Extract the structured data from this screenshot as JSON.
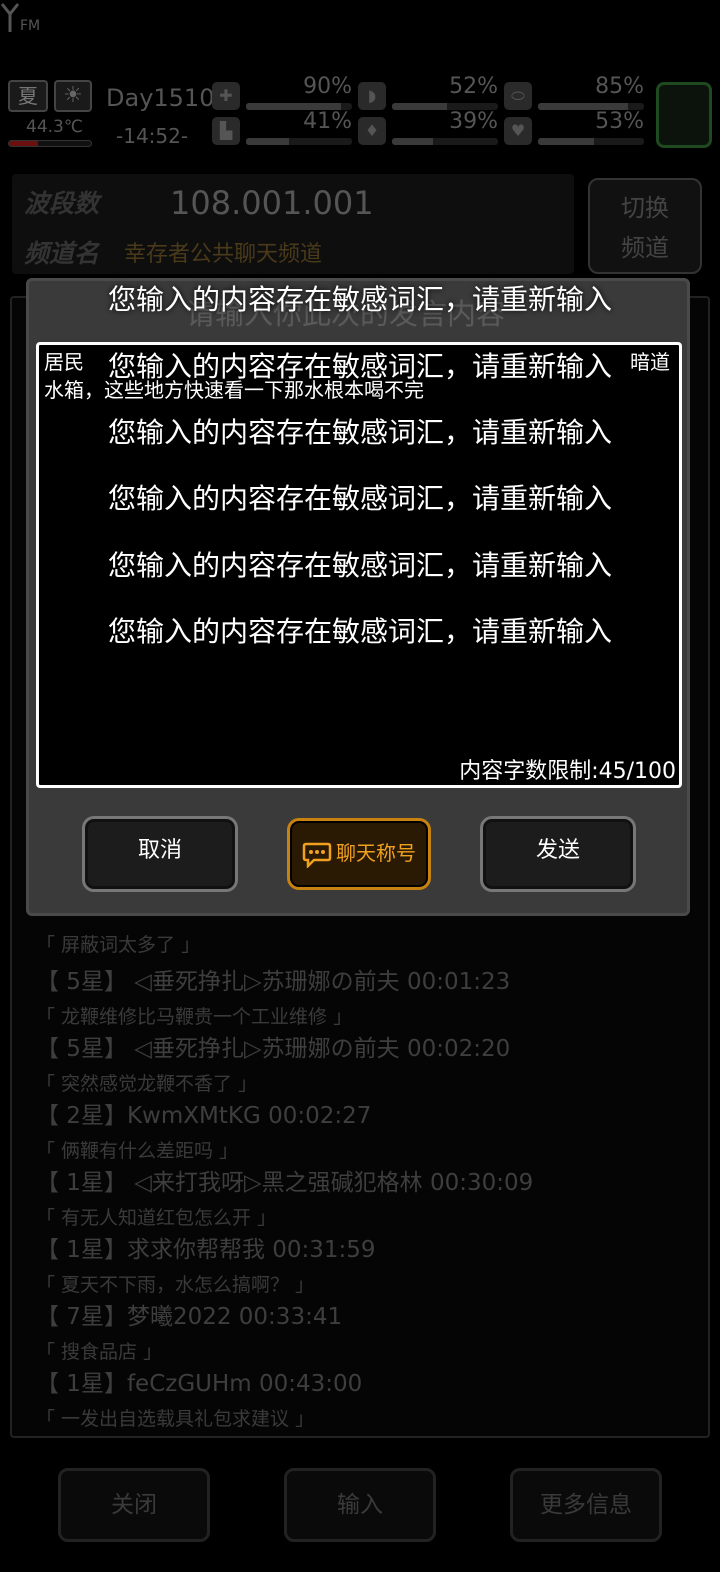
{
  "status": {
    "season": "夏",
    "temperature": "44.3℃",
    "temperature_level": 0.35,
    "day": "Day1510",
    "time": "-14:52-",
    "stats": [
      {
        "icon": "medkit-icon",
        "glyph": "✚",
        "value": "90%",
        "level": 0.9
      },
      {
        "icon": "boot-icon",
        "glyph": "▙",
        "value": "41%",
        "level": 0.41
      },
      {
        "icon": "stomach-icon",
        "glyph": "◗",
        "value": "52%",
        "level": 0.52
      },
      {
        "icon": "water-drop-icon",
        "glyph": "♦",
        "value": "39%",
        "level": 0.39
      },
      {
        "icon": "capsule-icon",
        "glyph": "⬭",
        "value": "85%",
        "level": 0.85
      },
      {
        "icon": "heart-icon",
        "glyph": "♥",
        "value": "53%",
        "level": 0.53
      }
    ]
  },
  "radio": {
    "band_label": "波段数",
    "frequency": "108.001.001",
    "channel_label": "频道名",
    "channel_name": "幸存者公共聊天频道",
    "switch_label_1": "切换",
    "switch_label_2": "频道"
  },
  "chat": {
    "messages": [
      {
        "head": "",
        "text": "「 屏蔽词太多了 」"
      },
      {
        "head": "【 5星】 ◁垂死挣扎▷苏珊娜の前夫 00:01:23",
        "text": "「 龙鞭维修比马鞭贵一个工业维修 」"
      },
      {
        "head": "【 5星】 ◁垂死挣扎▷苏珊娜の前夫 00:02:20",
        "text": "「 突然感觉龙鞭不香了 」"
      },
      {
        "head": "【 2星】KwmXMtKG 00:02:27",
        "text": "「 俩鞭有什么差距吗 」"
      },
      {
        "head": "【 1星】 ◁来打我呀▷黑之强碱犯格林 00:30:09",
        "text": "「 有无人知道红包怎么开 」"
      },
      {
        "head": "【 1星】求求你帮帮我 00:31:59",
        "text": "「 夏天不下雨，水怎么搞啊？ 」"
      },
      {
        "head": "【 7星】梦曦2022 00:33:41",
        "text": "「 搜食品店 」"
      },
      {
        "head": "【 1星】feCzGUHm 00:43:00",
        "text": "「 一发出自选载具礼包求建议 」"
      }
    ]
  },
  "bottom": {
    "close": "关闭",
    "input": "输入",
    "more": "更多信息"
  },
  "modal": {
    "title": "请输入你此次的发言内容",
    "typed_line1_start": "居民",
    "typed_line1_end": "暗道",
    "typed_line2": "水箱，这些地方快速看一下那水根本喝不完",
    "char_limit": "内容字数限制:45/100",
    "cancel": "取消",
    "nickname": "聊天称号",
    "send": "发送"
  },
  "toasts": [
    "您输入的内容存在敏感词汇，请重新输入",
    "您输入的内容存在敏感词汇，请重新输入",
    "您输入的内容存在敏感词汇，请重新输入",
    "您输入的内容存在敏感词汇，请重新输入",
    "您输入的内容存在敏感词汇，请重新输入",
    "您输入的内容存在敏感词汇，请重新输入"
  ]
}
